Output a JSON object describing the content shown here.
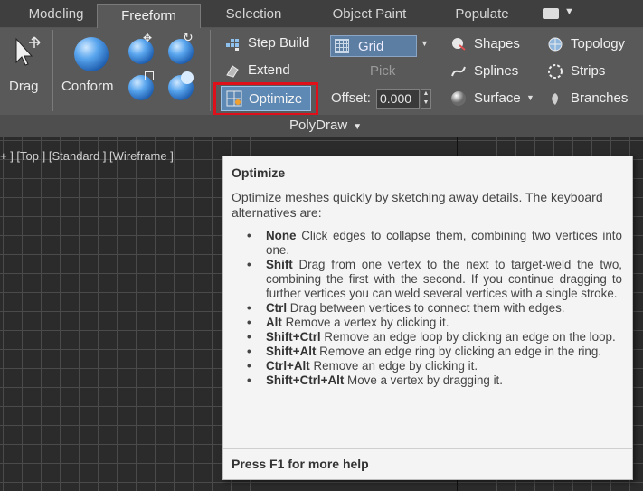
{
  "tabs": [
    {
      "label": "Modeling",
      "active": false
    },
    {
      "label": "Freeform",
      "active": true
    },
    {
      "label": "Selection",
      "active": false
    },
    {
      "label": "Object Paint",
      "active": false
    },
    {
      "label": "Populate",
      "active": false
    }
  ],
  "ribbon": {
    "drag_label": "Drag",
    "conform_label": "Conform",
    "step_build_label": "Step Build",
    "extend_label": "Extend",
    "optimize_label": "Optimize",
    "grid_label": "Grid",
    "pick_label": "Pick",
    "offset_label": "Offset:",
    "offset_value": "0.000",
    "shapes_label": "Shapes",
    "splines_label": "Splines",
    "surface_label": "Surface",
    "topology_label": "Topology",
    "strips_label": "Strips",
    "branches_label": "Branches",
    "panel_label": "PolyDraw",
    "highlight_color": "#e0101a"
  },
  "viewport": {
    "label": "+ ] [Top ] [Standard ] [Wireframe ]"
  },
  "tooltip": {
    "title": "Optimize",
    "description": "Optimize meshes quickly by sketching away details. The keyboard alternatives are:",
    "items": [
      {
        "key": "None",
        "text": "Click edges to collapse them, combining two vertices into one."
      },
      {
        "key": "Shift",
        "text": "Drag from one vertex to the next to target-weld the two, combining the first with the second. If you continue dragging to further vertices you can weld several vertices with a single stroke."
      },
      {
        "key": "Ctrl",
        "text": "Drag between vertices to connect them with edges."
      },
      {
        "key": "Alt",
        "text": "Remove a vertex by clicking it."
      },
      {
        "key": "Shift+Ctrl",
        "text": "Remove an edge loop by clicking an edge on the loop."
      },
      {
        "key": "Shift+Alt",
        "text": "Remove an edge ring by clicking an edge in the ring."
      },
      {
        "key": "Ctrl+Alt",
        "text": "Remove an edge by clicking it."
      },
      {
        "key": "Shift+Ctrl+Alt",
        "text": "Move a vertex by dragging it."
      }
    ],
    "footer": "Press F1 for more help"
  }
}
